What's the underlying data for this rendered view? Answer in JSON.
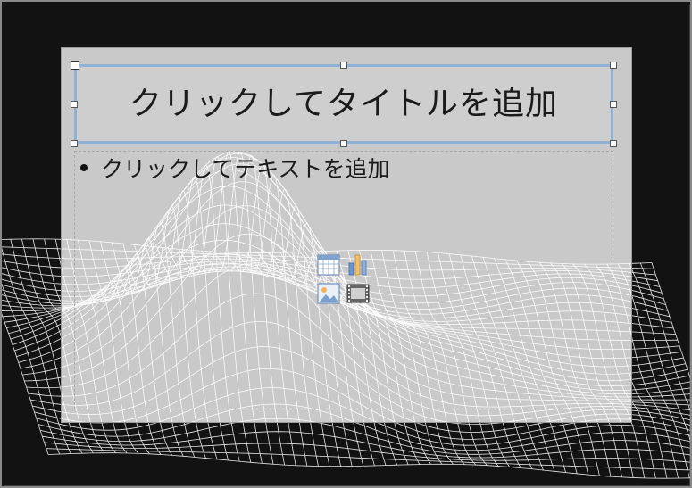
{
  "slide": {
    "title_placeholder": "クリックしてタイトルを追加",
    "body_placeholder": "クリックしてテキストを追加"
  },
  "insert_icons": [
    {
      "name": "insert-table-icon"
    },
    {
      "name": "insert-chart-icon"
    },
    {
      "name": "insert-picture-icon"
    },
    {
      "name": "insert-video-icon"
    }
  ],
  "colors": {
    "background": "#121212",
    "slide": "#d4d4d4",
    "selection_border": "#8fb1d6",
    "wireframe": "#ffffff"
  }
}
